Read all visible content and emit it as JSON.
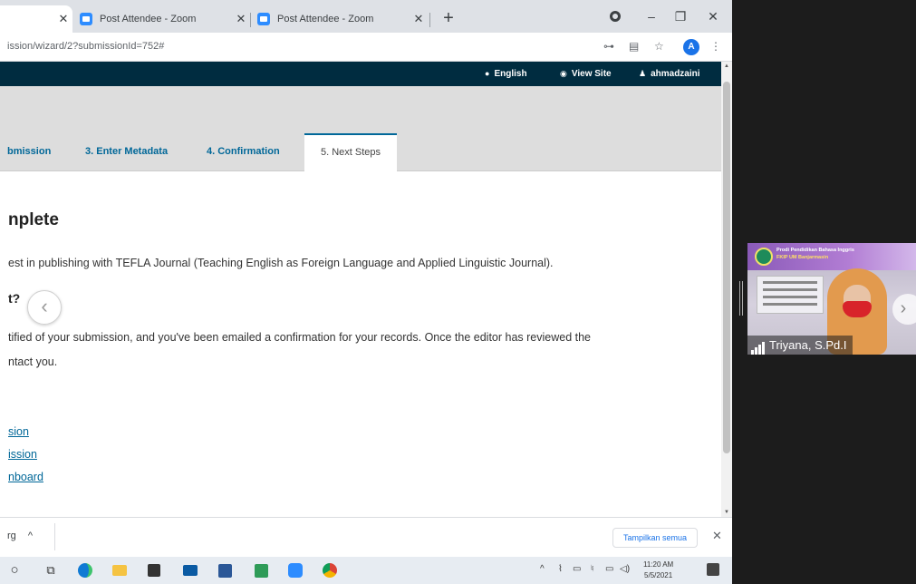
{
  "browser": {
    "tabs": [
      {
        "title": ""
      },
      {
        "title": "Post Attendee - Zoom"
      },
      {
        "title": "Post Attendee - Zoom"
      }
    ],
    "url": "ission/wizard/2?submissionId=752#",
    "avatar_letter": "A",
    "accent": "#1a73e8"
  },
  "site": {
    "header_bg": "#002c40",
    "language_label": "English",
    "view_site_label": "View Site",
    "username": "ahmadzaini"
  },
  "wizard": {
    "tabs": [
      {
        "label": "bmission"
      },
      {
        "label": "3. Enter Metadata"
      },
      {
        "label": "4. Confirmation"
      },
      {
        "label": "5. Next Steps"
      }
    ],
    "active_tab": "5. Next Steps",
    "link_color": "#006798"
  },
  "content": {
    "heading": "nplete",
    "intro": "est in publishing with TEFLA Journal (Teaching English as Foreign Language and Applied Linguistic Journal).",
    "subheading": "t?",
    "para1_line1": "tified of your submission, and you've been emailed a confirmation for your records. Once the editor has reviewed the",
    "para1_line2": "ntact you.",
    "links": [
      "sion",
      "ission",
      "nboard"
    ]
  },
  "downloads": {
    "item": "rg",
    "show_all": "Tampilkan semua"
  },
  "taskbar": {
    "clock_time": "11:20 AM",
    "clock_date": "5/5/2021"
  },
  "zoom_tile": {
    "name": "Triyana, S.Pd.I",
    "org_line1": "Prodi Pendidikan Bahasa Inggris",
    "org_line2": "FKIP UM Banjarmasin"
  }
}
